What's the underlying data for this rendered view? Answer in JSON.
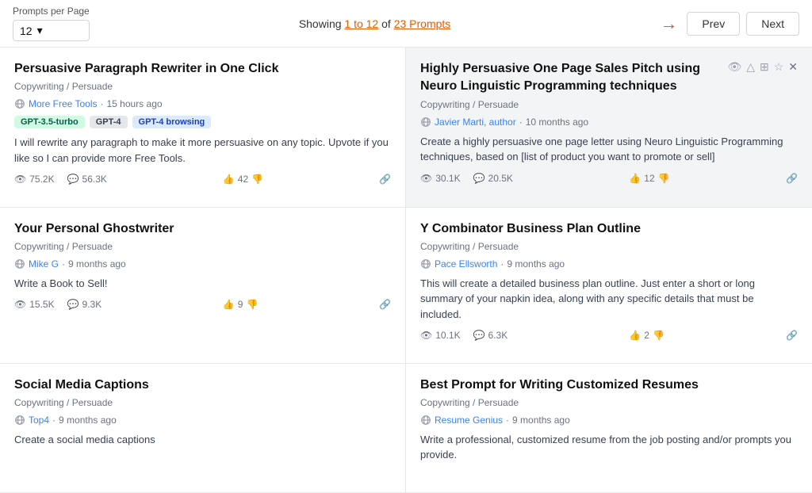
{
  "topbar": {
    "per_page_label": "Prompts per Page",
    "per_page_value": "12",
    "showing_text_prefix": "Showing ",
    "showing_range": "1 to 12",
    "showing_of": " of ",
    "showing_total": "23 Prompts",
    "prev_label": "Prev",
    "next_label": "Next"
  },
  "prompts": [
    {
      "id": 1,
      "title": "Persuasive Paragraph Rewriter in One Click",
      "category": "Copywriting / Persuade",
      "author": "More Free Tools",
      "author_link": true,
      "time_ago": "15 hours ago",
      "tags": [
        {
          "label": "GPT-3.5-turbo",
          "style": "green"
        },
        {
          "label": "GPT-4",
          "style": "gray"
        },
        {
          "label": "GPT-4 browsing",
          "style": "blue"
        }
      ],
      "description": "I will rewrite any paragraph to make it more persuasive on any topic. Upvote if you like so I can provide more Free Tools.",
      "views": "75.2K",
      "comments": "56.3K",
      "votes_up": "42",
      "votes_down": "",
      "highlighted": false,
      "show_close": false
    },
    {
      "id": 2,
      "title": "Highly Persuasive One Page Sales Pitch using Neuro Linguistic Programming techniques",
      "category": "Copywriting / Persuade",
      "author": "Javier Marti, author",
      "author_link": true,
      "time_ago": "10 months ago",
      "tags": [],
      "description": "Create a highly persuasive one page letter using Neuro Linguistic Programming techniques, based on [list of product you want to promote or sell]",
      "views": "30.1K",
      "comments": "20.5K",
      "votes_up": "12",
      "votes_down": "",
      "highlighted": true,
      "show_close": true
    },
    {
      "id": 3,
      "title": "Your Personal Ghostwriter",
      "category": "Copywriting / Persuade",
      "author": "Mike G",
      "author_link": true,
      "time_ago": "9 months ago",
      "tags": [],
      "description": "Write a Book to Sell!",
      "views": "15.5K",
      "comments": "9.3K",
      "votes_up": "9",
      "votes_down": "",
      "highlighted": false,
      "show_close": false
    },
    {
      "id": 4,
      "title": "Y Combinator Business Plan Outline",
      "category": "Copywriting / Persuade",
      "author": "Pace Ellsworth",
      "author_link": true,
      "time_ago": "9 months ago",
      "tags": [],
      "description": "This will create a detailed business plan outline. Just enter a short or long summary of your napkin idea, along with any specific details that must be included.",
      "views": "10.1K",
      "comments": "6.3K",
      "votes_up": "2",
      "votes_down": "",
      "highlighted": false,
      "show_close": false
    },
    {
      "id": 5,
      "title": "Social Media Captions",
      "category": "Copywriting / Persuade",
      "author": "Top4",
      "author_link": true,
      "time_ago": "9 months ago",
      "tags": [],
      "description": "Create a social media captions",
      "views": "",
      "comments": "",
      "votes_up": "",
      "votes_down": "",
      "highlighted": false,
      "show_close": false
    },
    {
      "id": 6,
      "title": "Best Prompt for Writing Customized Resumes",
      "category": "Copywriting / Persuade",
      "author": "Resume Genius",
      "author_link": true,
      "time_ago": "9 months ago",
      "tags": [],
      "description": "Write a professional, customized resume from the job posting and/or prompts you provide.",
      "views": "",
      "comments": "",
      "votes_up": "",
      "votes_down": "",
      "highlighted": false,
      "show_close": false
    }
  ]
}
